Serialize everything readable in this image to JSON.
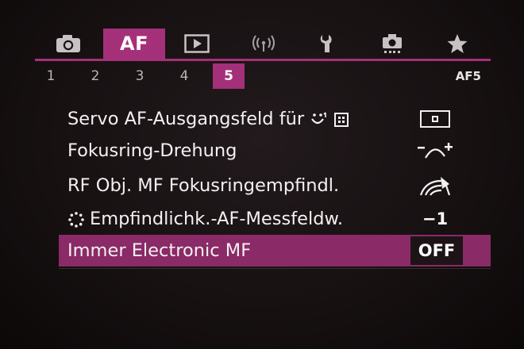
{
  "tabs": {
    "af_label": "AF",
    "icons": [
      "camera-shooting-icon",
      "af-tab",
      "playback-icon",
      "wireless-icon",
      "wrench-setup-icon",
      "custom-functions-icon",
      "my-menu-star-icon"
    ],
    "active": "af"
  },
  "subpages": {
    "numbers": [
      "1",
      "2",
      "3",
      "4",
      "5"
    ],
    "active": "5",
    "page_code": "AF5"
  },
  "menu": {
    "items": [
      {
        "label": "Servo AF-Ausgangsfeld für",
        "value_icon": "af-point-frame-icon"
      },
      {
        "label": "Fokusring-Drehung",
        "value_icon": "focus-ring-direction-icon"
      },
      {
        "label": "RF Obj. MF Fokusringempfindl.",
        "value_icon": "focus-ring-sensitivity-icon"
      },
      {
        "label": "Empfindlichk.-AF-Messfeldw.",
        "value": "−1"
      },
      {
        "label": "Immer Electronic MF",
        "value": "OFF",
        "selected": true
      }
    ]
  },
  "colors": {
    "accent": "#a5307a",
    "selected_row": "#8a2a67",
    "background": "#171112",
    "text": "#f4f0f1"
  }
}
